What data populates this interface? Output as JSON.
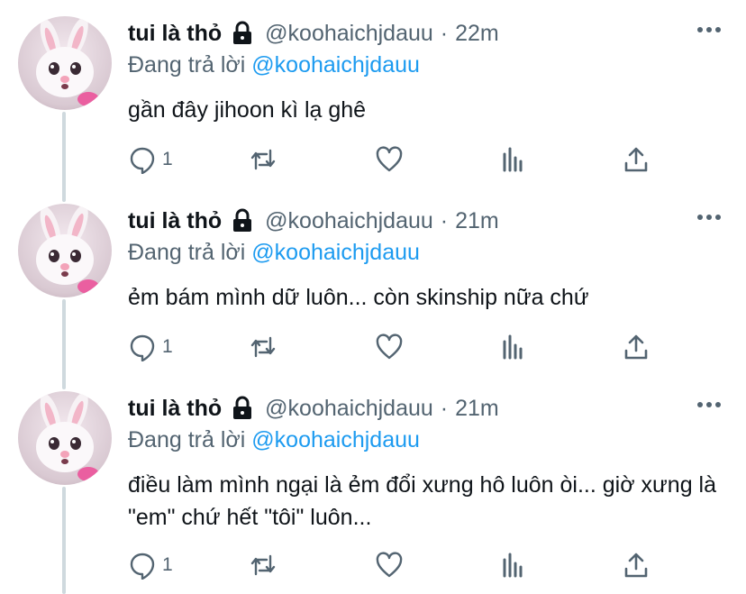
{
  "tweets": [
    {
      "name": "tui là thỏ",
      "handle": "@koohaichjdauu",
      "dot": "·",
      "time": "22m",
      "reply_prefix": "Đang trả lời",
      "reply_mention": "@koohaichjdauu",
      "text": "gần đây jihoon kì lạ ghê",
      "reply_count": "1"
    },
    {
      "name": "tui là thỏ",
      "handle": "@koohaichjdauu",
      "dot": "·",
      "time": "21m",
      "reply_prefix": "Đang trả lời",
      "reply_mention": "@koohaichjdauu",
      "text": "ẻm bám mình dữ luôn... còn skinship nữa chứ",
      "reply_count": "1"
    },
    {
      "name": "tui là thỏ",
      "handle": "@koohaichjdauu",
      "dot": "·",
      "time": "21m",
      "reply_prefix": "Đang trả lời",
      "reply_mention": "@koohaichjdauu",
      "text": "điều làm mình ngại là ẻm đổi xưng hô luôn òi... giờ xưng là \"em\" chứ hết \"tôi\" luôn...",
      "reply_count": "1"
    }
  ],
  "icons": {
    "protected": "lock-icon",
    "more": "more-icon",
    "reply": "reply-icon",
    "retweet": "retweet-icon",
    "like": "like-icon",
    "views": "views-icon",
    "share": "share-icon"
  },
  "colors": {
    "text": "#0f1419",
    "secondary": "#536471",
    "accent": "#1d9bf0",
    "thread_line": "#cfd9de"
  }
}
